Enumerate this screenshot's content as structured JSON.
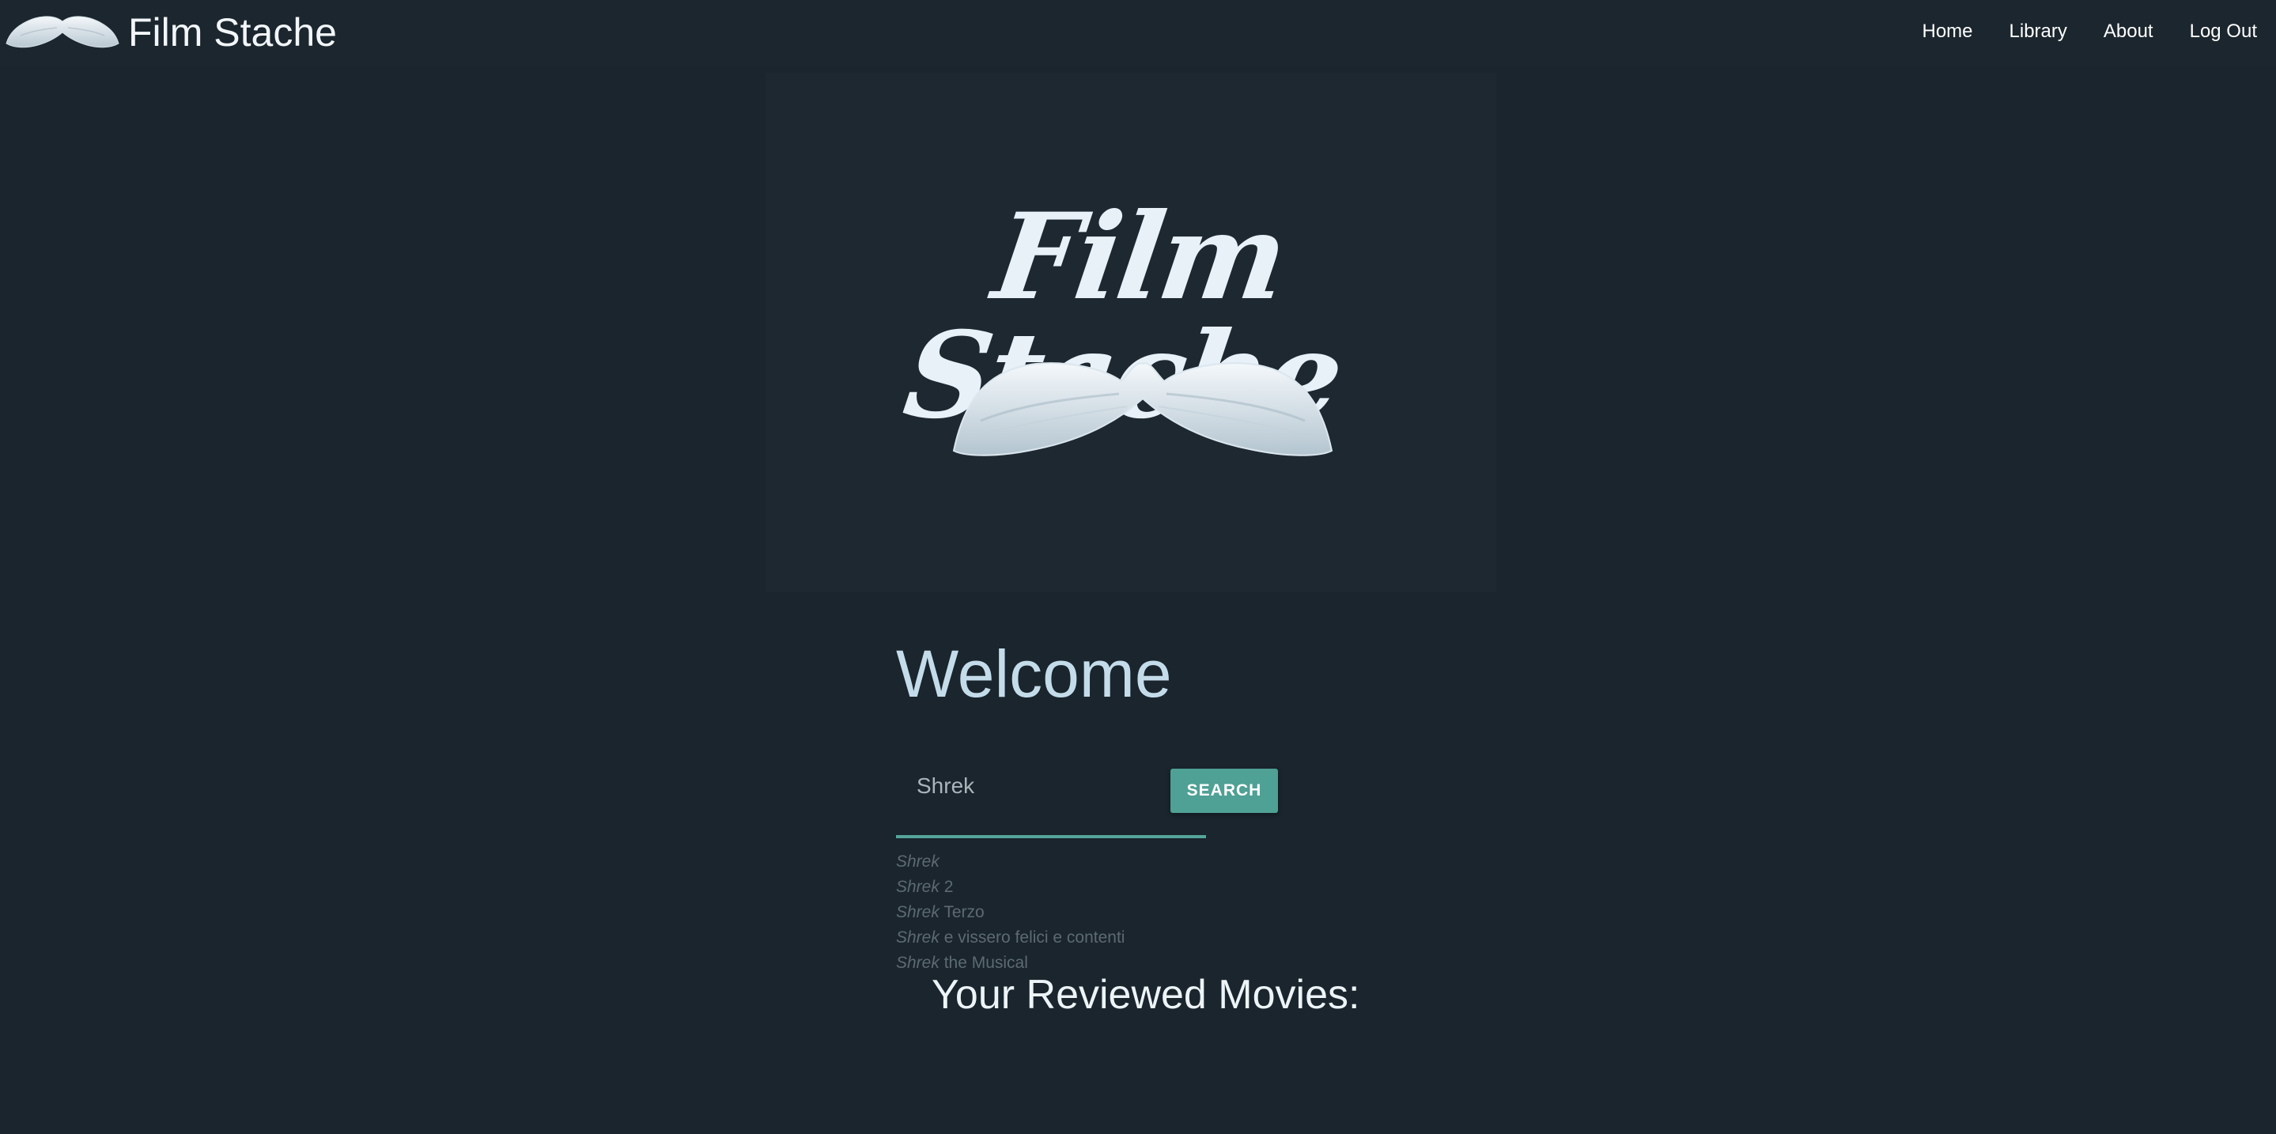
{
  "header": {
    "brand": "Film Stache",
    "logo_icon": "mustache-icon",
    "nav": [
      {
        "label": "Home"
      },
      {
        "label": "Library"
      },
      {
        "label": "About"
      },
      {
        "label": "Log Out"
      }
    ]
  },
  "hero": {
    "title": "Film Stache",
    "graphic_icon": "mustache-icon"
  },
  "main": {
    "welcome": "Welcome",
    "search": {
      "value": "Shrek",
      "button_label": "SEARCH"
    },
    "suggestions": [
      {
        "match": "Shrek",
        "rest": ""
      },
      {
        "match": "Shrek",
        "rest": " 2"
      },
      {
        "match": "Shrek",
        "rest": " Terzo"
      },
      {
        "match": "Shrek",
        "rest": " e vissero felici e contenti"
      },
      {
        "match": "Shrek",
        "rest": " the Musical"
      }
    ],
    "reviewed_heading": "Your Reviewed Movies:"
  },
  "colors": {
    "background": "#1a252d",
    "accent": "#4fa095",
    "welcome_text": "#c4dcea"
  }
}
